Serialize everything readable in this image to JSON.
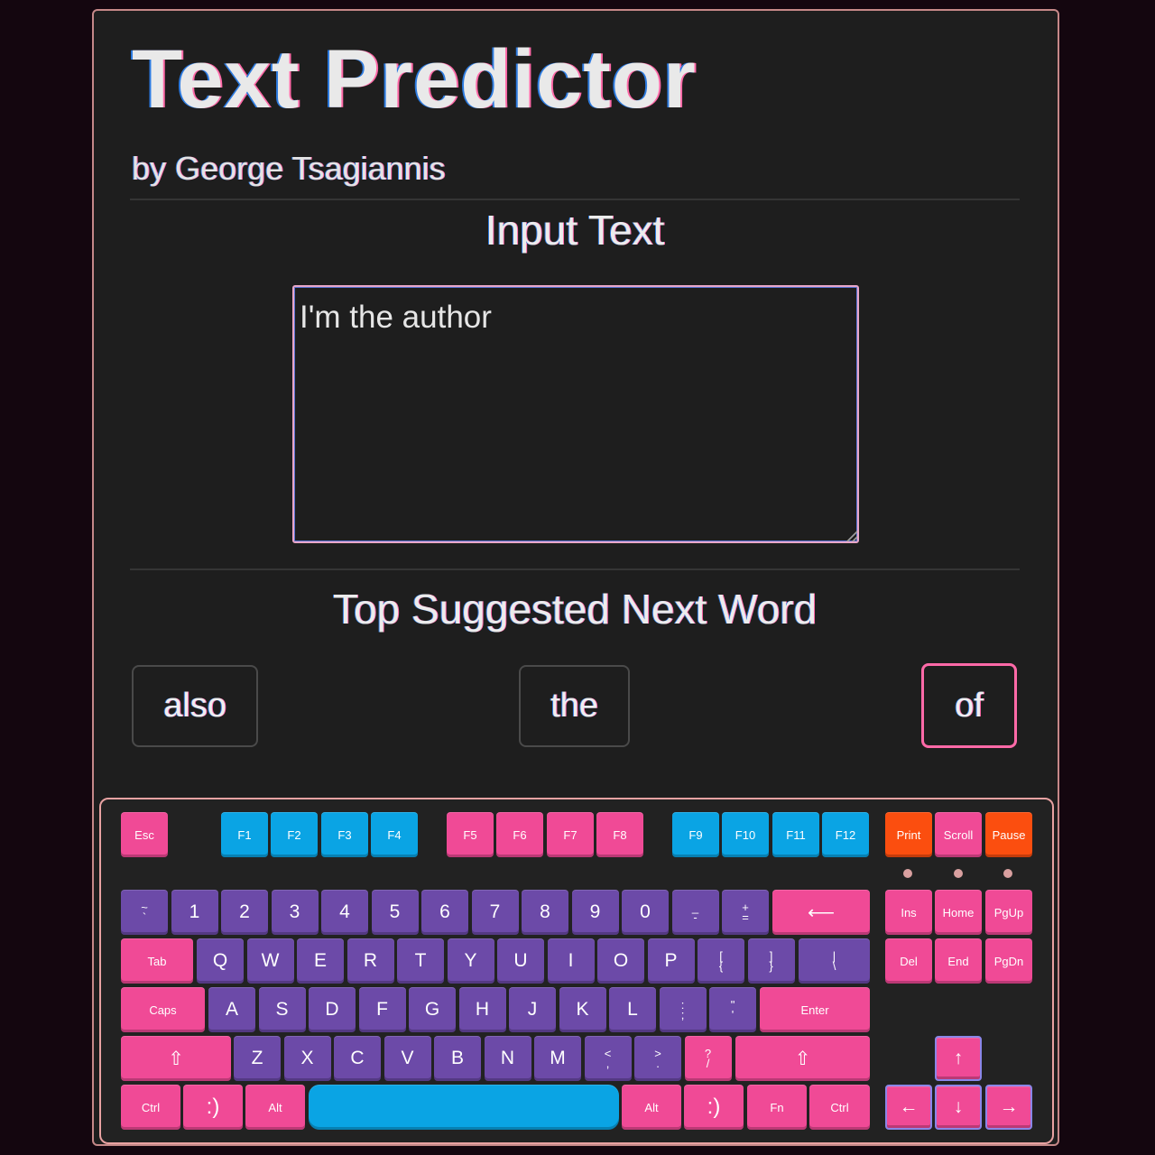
{
  "header": {
    "title": "Text Predictor",
    "byline": "by George Tsagiannis"
  },
  "input_section": {
    "heading": "Input Text",
    "value": "I'm the author"
  },
  "suggestion_section": {
    "heading": "Top Suggested Next Word",
    "words": [
      "also",
      "the",
      "of"
    ],
    "selected_index": 2
  },
  "keyboard": {
    "colors": {
      "pink": "#f04a96",
      "blue": "#0aa4e4",
      "purple": "#6c4aa8",
      "orange": "#fb4e0f",
      "border": "#e8a2a2",
      "arrow_outline": "#8a86e8"
    },
    "function_row": [
      "Esc",
      "F1",
      "F2",
      "F3",
      "F4",
      "F5",
      "F6",
      "F7",
      "F8",
      "F9",
      "F10",
      "F11",
      "F12",
      "Print",
      "Scroll",
      "Pause"
    ],
    "number_row": [
      "~`",
      "1",
      "2",
      "3",
      "4",
      "5",
      "6",
      "7",
      "8",
      "9",
      "0",
      "_-",
      "+=",
      "⟵"
    ],
    "top_row": [
      "Tab",
      "Q",
      "W",
      "E",
      "R",
      "T",
      "Y",
      "U",
      "I",
      "O",
      "P",
      "[{",
      "]}",
      "|\\"
    ],
    "home_row": [
      "Caps",
      "A",
      "S",
      "D",
      "F",
      "G",
      "H",
      "J",
      "K",
      "L",
      ":;",
      "\"'",
      "Enter"
    ],
    "shift_row": [
      "⇧",
      "Z",
      "X",
      "C",
      "V",
      "B",
      "N",
      "M",
      "<,",
      ">.",
      "?/",
      "⇧"
    ],
    "bottom_row": [
      "Ctrl",
      ":)",
      "Alt",
      "",
      "Alt",
      ":)",
      "Fn",
      "Ctrl"
    ],
    "nav_keys": [
      "Ins",
      "Home",
      "PgUp",
      "Del",
      "End",
      "PgDn"
    ],
    "arrow_keys": [
      "↑",
      "←",
      "↓",
      "→"
    ]
  }
}
